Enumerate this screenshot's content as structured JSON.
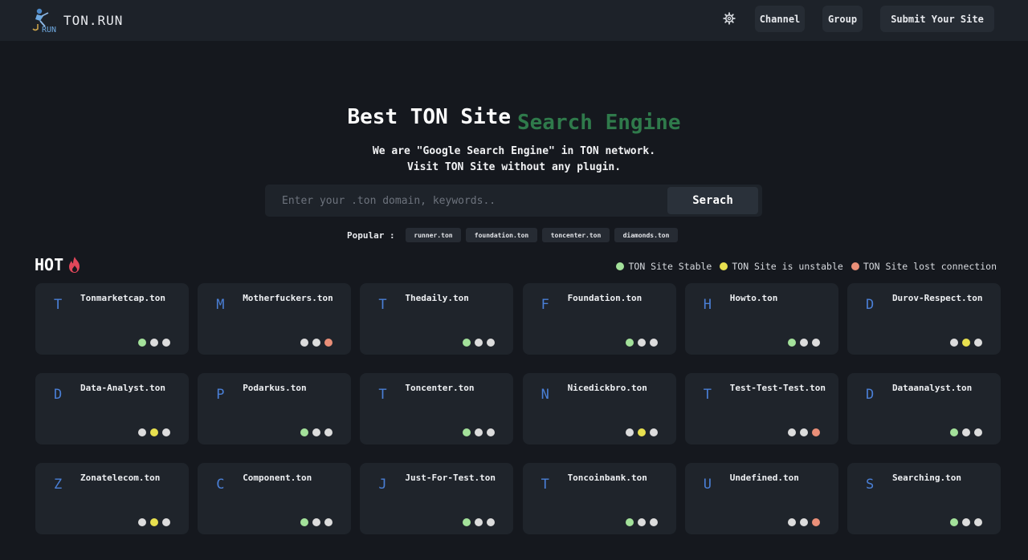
{
  "header": {
    "brand": "TON.RUN",
    "nav": [
      {
        "label": "Channel"
      },
      {
        "label": "Group"
      },
      {
        "label": "Submit Your Site"
      }
    ]
  },
  "hero": {
    "title_part1": "Best TON Site",
    "title_part2": "Search Engine",
    "subtitle_line1": "We are \"Google Search Engine\" in TON network.",
    "subtitle_line2": "Visit TON Site without any plugin."
  },
  "search": {
    "placeholder": "Enter your .ton domain, keywords..",
    "value": "",
    "button_label": "Serach"
  },
  "popular": {
    "label": "Popular :",
    "chips": [
      "runner.ton",
      "foundation.ton",
      "toncenter.ton",
      "diamonds.ton"
    ]
  },
  "hot": {
    "label": "HOT"
  },
  "legend": [
    {
      "label": "TON Site Stable",
      "color": "#a3e19a"
    },
    {
      "label": "TON Site is unstable",
      "color": "#e8e04f"
    },
    {
      "label": "TON Site lost connection",
      "color": "#ea8f78"
    }
  ],
  "status_colors": {
    "stable": "#a3e19a",
    "unstable": "#e8e04f",
    "lost": "#ea8f78",
    "inactive": "#dcdcdc"
  },
  "sites": [
    {
      "letter": "T",
      "name": "Tonmarketcap.ton",
      "dots": [
        "stable",
        "inactive",
        "inactive"
      ]
    },
    {
      "letter": "M",
      "name": "Motherfuckers.ton",
      "dots": [
        "inactive",
        "inactive",
        "lost"
      ]
    },
    {
      "letter": "T",
      "name": "Thedaily.ton",
      "dots": [
        "stable",
        "inactive",
        "inactive"
      ]
    },
    {
      "letter": "F",
      "name": "Foundation.ton",
      "dots": [
        "stable",
        "inactive",
        "inactive"
      ]
    },
    {
      "letter": "H",
      "name": "Howto.ton",
      "dots": [
        "stable",
        "inactive",
        "inactive"
      ]
    },
    {
      "letter": "D",
      "name": "Durov-Respect.ton",
      "dots": [
        "inactive",
        "unstable",
        "inactive"
      ]
    },
    {
      "letter": "D",
      "name": "Data-Analyst.ton",
      "dots": [
        "inactive",
        "unstable",
        "inactive"
      ]
    },
    {
      "letter": "P",
      "name": "Podarkus.ton",
      "dots": [
        "stable",
        "inactive",
        "inactive"
      ]
    },
    {
      "letter": "T",
      "name": "Toncenter.ton",
      "dots": [
        "stable",
        "inactive",
        "inactive"
      ]
    },
    {
      "letter": "N",
      "name": "Nicedickbro.ton",
      "dots": [
        "inactive",
        "unstable",
        "inactive"
      ]
    },
    {
      "letter": "T",
      "name": "Test-Test-Test.ton",
      "dots": [
        "inactive",
        "inactive",
        "lost"
      ]
    },
    {
      "letter": "D",
      "name": "Dataanalyst.ton",
      "dots": [
        "stable",
        "inactive",
        "inactive"
      ]
    },
    {
      "letter": "Z",
      "name": "Zonatelecom.ton",
      "dots": [
        "inactive",
        "unstable",
        "inactive"
      ]
    },
    {
      "letter": "C",
      "name": "Component.ton",
      "dots": [
        "stable",
        "inactive",
        "inactive"
      ]
    },
    {
      "letter": "J",
      "name": "Just-For-Test.ton",
      "dots": [
        "stable",
        "inactive",
        "inactive"
      ]
    },
    {
      "letter": "T",
      "name": "Toncoinbank.ton",
      "dots": [
        "stable",
        "inactive",
        "inactive"
      ]
    },
    {
      "letter": "U",
      "name": "Undefined.ton",
      "dots": [
        "inactive",
        "inactive",
        "lost"
      ]
    },
    {
      "letter": "S",
      "name": "Searching.ton",
      "dots": [
        "stable",
        "inactive",
        "inactive"
      ]
    }
  ]
}
